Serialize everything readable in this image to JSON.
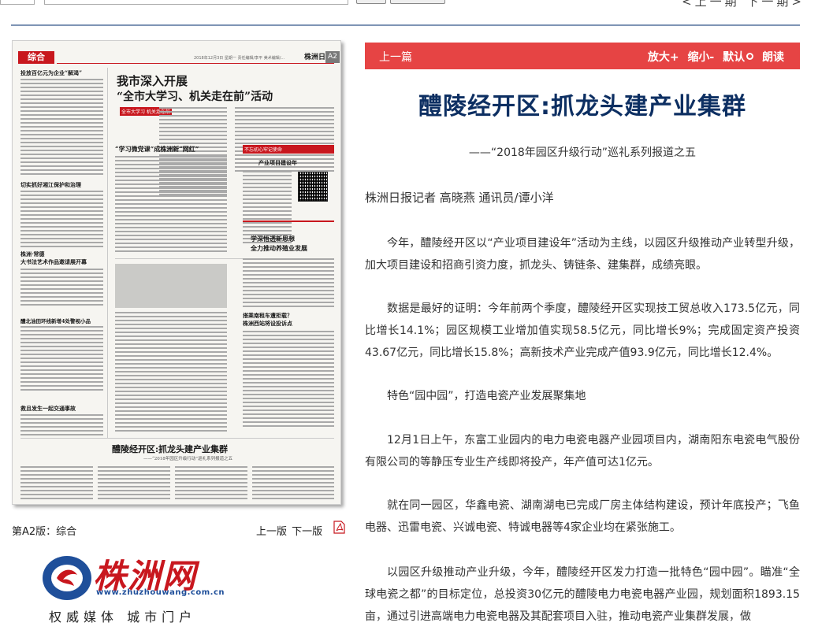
{
  "topbar": {
    "period_nav": "<上一期 下一期>"
  },
  "newspaper_page": {
    "section_tag": "综合",
    "masthead": "株洲日报",
    "page_no": "A2",
    "date_line": "2018年12月3日 星期一 责任编辑/李平 美术编辑/...",
    "headlines": {
      "h1": "我市深入开展",
      "h2": "“全市大学习、机关走在前”活动",
      "h3": "“学习微党课”成株洲新“网红”",
      "h4": "搭乘南租车遭拒载？",
      "h5": "株洲西站将设投诉点",
      "h6": "学深悟透新思想",
      "h7": "全力推动养殖业发展",
      "h8": "醴陵经开区:抓龙头建产业集群",
      "h9": "——“2018年园区升级行动”巡礼系列报道之五",
      "left1": "投放百亿元为企业“解渴”",
      "left2": "切实抓好湘江保护和治理",
      "left3": "株洲·常德",
      "left4": "大书法艺术作品邀请展开幕",
      "left5": "醴北油田环线新增4处警视小品",
      "left6": "救且发生一起交通事故",
      "red_tag1": "全市大学习 机关走在前",
      "red_tag2": "产业项目建设年",
      "red_tag3": "不忘初心牢记使命"
    }
  },
  "page_caption": "第A2版：综合",
  "page_nav": {
    "prev": "上一版",
    "next": "下一版"
  },
  "logo": {
    "name": "株洲网",
    "url": "www.zhuzhouwang.com.cn",
    "slogan": "权威媒体  城市门户"
  },
  "toolbar": {
    "prev_article": "上一篇",
    "zoom_in": "放大+",
    "zoom_out": "缩小-",
    "default": "默认",
    "read_aloud": "朗读"
  },
  "article": {
    "title": "醴陵经开区:抓龙头建产业集群",
    "subtitle": "——“2018年园区升级行动”巡礼系列报道之五",
    "byline": "株洲日报记者 高晓燕 通讯员/谭小洋",
    "paragraphs": [
      "今年，醴陵经开区以“产业项目建设年”活动为主线，以园区升级推动产业转型升级，加大项目建设和招商引资力度，抓龙头、铸链条、建集群，成绩亮眼。",
      "数据是最好的证明：今年前两个季度，醴陵经开区实现技工贸总收入173.5亿元，同比增长14.1%；园区规模工业增加值实现58.5亿元，同比增长9%；完成固定资产投资43.67亿元，同比增长15.8%；高新技术产业完成产值93.9亿元，同比增长12.4%。",
      "特色“园中园”，打造电瓷产业发展聚集地",
      "12月1日上午，东富工业园内的电力电瓷电器产业园项目内，湖南阳东电瓷电气股份有限公司的等静压专业生产线即将投产，年产值可达1亿元。",
      "就在同一园区，华鑫电瓷、湖南湖电已完成厂房主体结构建设，预计年底投产；飞鱼电器、迅雷电瓷、兴诚电瓷、特诚电器等4家企业均在紧张施工。",
      "以园区升级推动产业升级，今年，醴陵经开区发力打造一批特色“园中园”。瞄准“全球电瓷之都”的目标定位，总投资30亿元的醴陵电力电瓷电器产业园，规划面积1893.15亩，通过引进高端电力电瓷电器及其配套项目入驻，推动电瓷产业集群发展，做"
    ]
  },
  "colors": {
    "accent_red": "#e64444",
    "title_navy": "#0d2f62",
    "divider_blue": "#7f95b5"
  }
}
